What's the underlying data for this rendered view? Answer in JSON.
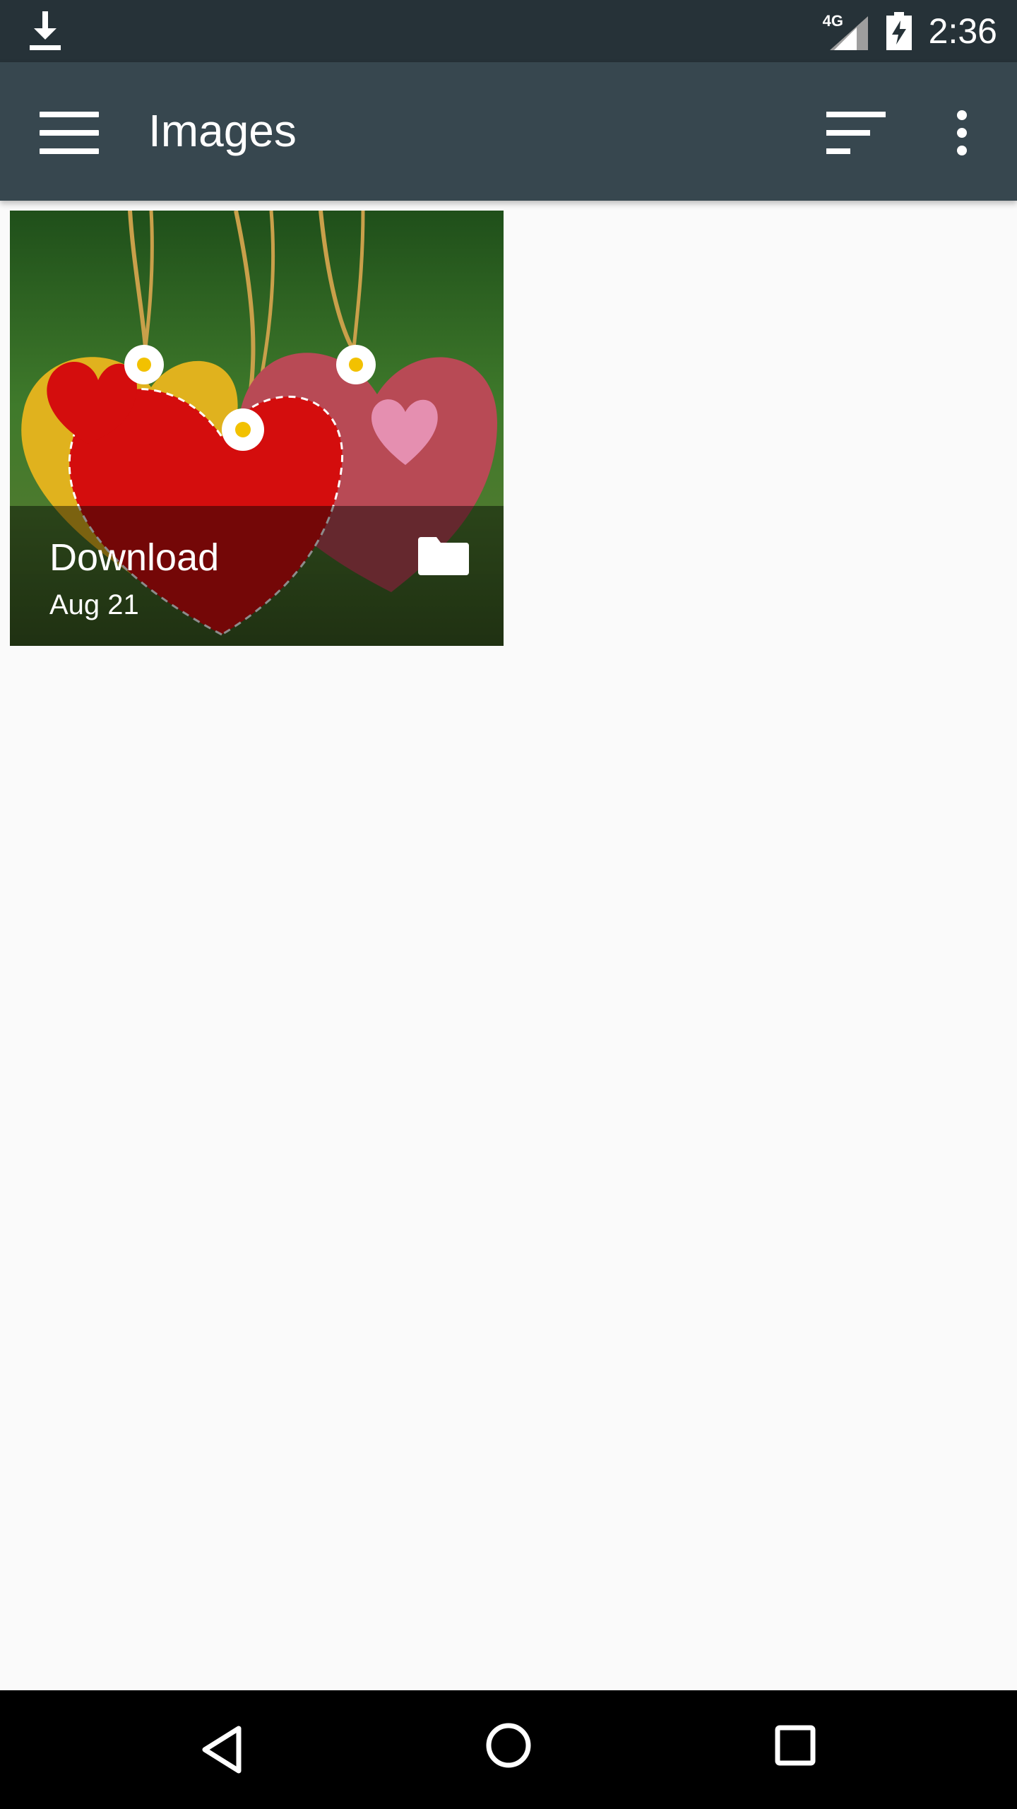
{
  "status_bar": {
    "network_label": "4G",
    "time": "2:36",
    "icons": [
      "download-icon",
      "signal-icon",
      "battery-charging-icon"
    ]
  },
  "app_bar": {
    "title": "Images",
    "icons": [
      "menu-icon",
      "sort-icon",
      "more-vert-icon"
    ]
  },
  "albums": [
    {
      "name": "Download",
      "date": "Aug 21",
      "icon": "folder-icon"
    }
  ],
  "nav_bar": {
    "icons": [
      "back-icon",
      "home-icon",
      "recents-icon"
    ]
  },
  "colors": {
    "status_bar_bg": "#263238",
    "app_bar_bg": "#37474f",
    "page_bg": "#fafafa",
    "nav_bar_bg": "#000000"
  }
}
